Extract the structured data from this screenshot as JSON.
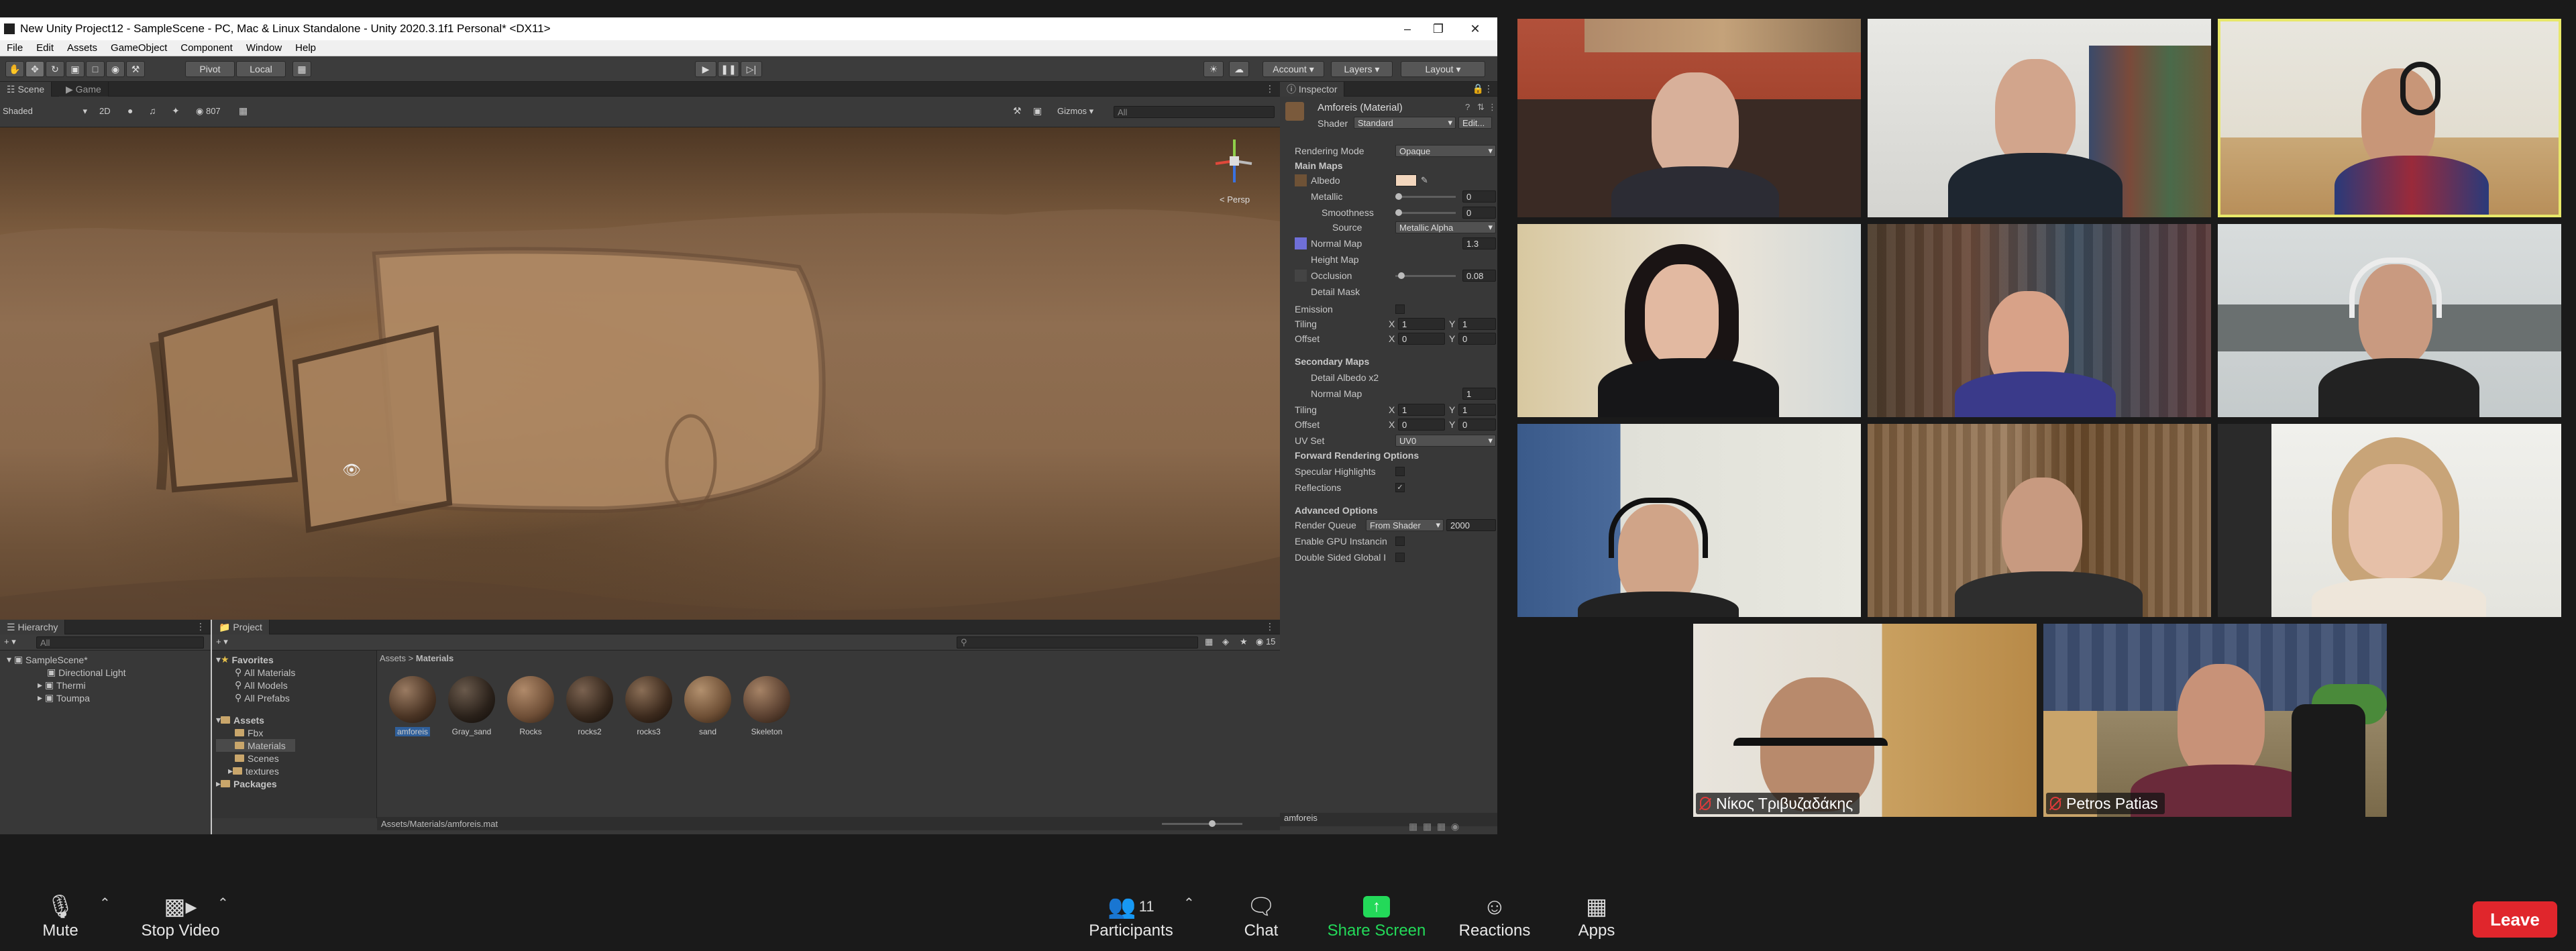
{
  "unity": {
    "window_title": "New Unity Project12 - SampleScene - PC, Mac & Linux Standalone - Unity 2020.3.1f1 Personal* <DX11>",
    "menu": [
      "File",
      "Edit",
      "Assets",
      "GameObject",
      "Component",
      "Window",
      "Help"
    ],
    "toolbar": {
      "pivot": "Pivot",
      "local": "Local",
      "account": "Account",
      "layers": "Layers",
      "layout": "Layout"
    },
    "scene_tabs": [
      "Scene",
      "Game"
    ],
    "scene_bar": {
      "shading": "Shaded",
      "mode_2d": "2D",
      "counter": "807",
      "gizmos": "Gizmos",
      "search": "All"
    },
    "gizmo_label": "< Persp",
    "hierarchy": {
      "title": "Hierarchy",
      "search": "All",
      "items": [
        "SampleScene*",
        "Directional Light",
        "Thermi",
        "Toumpa"
      ]
    },
    "project": {
      "title": "Project",
      "favorites": [
        "Favorites",
        "All Materials",
        "All Models",
        "All Prefabs"
      ],
      "assets_label": "Assets",
      "folders": [
        "Fbx",
        "Materials",
        "Scenes",
        "textures"
      ],
      "packages_label": "Packages",
      "breadcrumb": [
        "Assets",
        ">",
        "Materials"
      ],
      "materials": [
        "amforeis",
        "Gray_sand",
        "Rocks",
        "rocks2",
        "rocks3",
        "sand",
        "Skeleton"
      ],
      "status_path": "Assets/Materials/amforeis.mat"
    },
    "inspector": {
      "title": "Inspector",
      "material_name": "Amforeis (Material)",
      "shader_label": "Shader",
      "shader_value": "Standard",
      "edit_label": "Edit...",
      "rendering_mode_label": "Rendering Mode",
      "rendering_mode_value": "Opaque",
      "main_maps": "Main Maps",
      "albedo": "Albedo",
      "metallic": "Metallic",
      "metallic_value": "0",
      "smoothness": "Smoothness",
      "smoothness_value": "0",
      "source": "Source",
      "source_value": "Metallic Alpha",
      "normal_map": "Normal Map",
      "normal_value": "1.3",
      "height_map": "Height Map",
      "occlusion": "Occlusion",
      "occlusion_value": "0.08",
      "detail_mask": "Detail Mask",
      "emission": "Emission",
      "tiling": "Tiling",
      "offset": "Offset",
      "x": "X",
      "y": "Y",
      "tiling_x": "1",
      "tiling_y": "1",
      "offset_x": "0",
      "offset_y": "0",
      "secondary_maps": "Secondary Maps",
      "detail_albedo": "Detail Albedo x2",
      "normal_map2": "Normal Map",
      "normal2_value": "1",
      "tiling2_x": "1",
      "tiling2_y": "1",
      "offset2_x": "0",
      "offset2_y": "0",
      "uv_set": "UV Set",
      "uv_value": "UV0",
      "forward": "Forward Rendering Options",
      "specular": "Specular Highlights",
      "reflections": "Reflections",
      "advanced": "Advanced Options",
      "render_queue": "Render Queue",
      "render_queue_mode": "From Shader",
      "render_queue_value": "2000",
      "gpu_instancing": "Enable GPU Instancin",
      "double_sided": "Double Sided Global I",
      "footer": "amforeis"
    },
    "colors": {
      "albedo": "#f2d6bd",
      "normal": "#6f6fd8"
    }
  },
  "zoom": {
    "participants": [
      {
        "name": "",
        "speaking": false
      },
      {
        "name": "",
        "speaking": false
      },
      {
        "name": "",
        "speaking": true
      },
      {
        "name": "",
        "speaking": false
      },
      {
        "name": "",
        "speaking": false
      },
      {
        "name": "",
        "speaking": false
      },
      {
        "name": "",
        "speaking": false
      },
      {
        "name": "",
        "speaking": false
      },
      {
        "name": "",
        "speaking": false
      },
      {
        "name": "Νίκος Τριβυζαδάκης",
        "speaking": false
      },
      {
        "name": "Petros Patias",
        "speaking": false
      }
    ],
    "toolbar": {
      "mute": "Mute",
      "stop_video": "Stop Video",
      "participants": "Participants",
      "participants_count": "11",
      "chat": "Chat",
      "share_screen": "Share Screen",
      "reactions": "Reactions",
      "apps": "Apps",
      "leave": "Leave"
    },
    "colors": {
      "share": "#23d959",
      "leave": "#e0262c",
      "speaker_border": "#e8e86a"
    }
  }
}
